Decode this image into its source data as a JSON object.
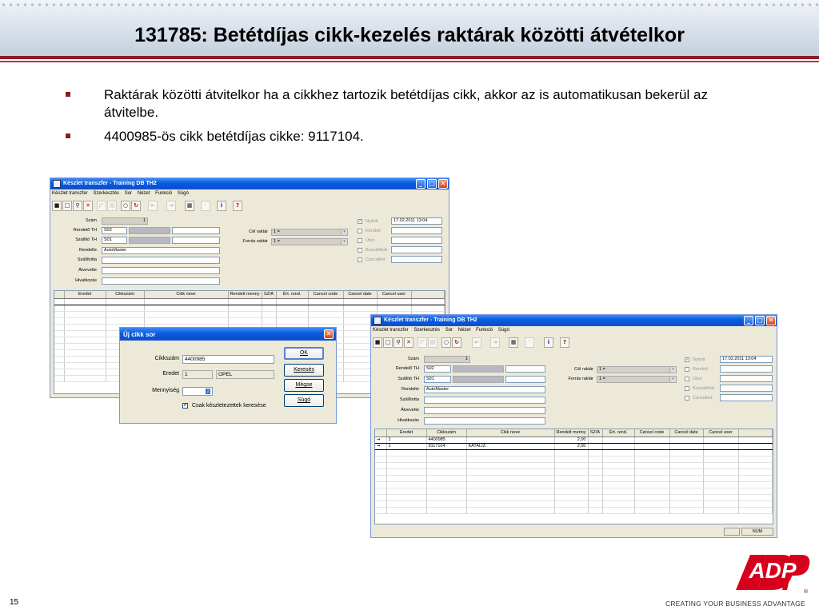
{
  "slide": {
    "title": "131785: Betétdíjas cikk-kezelés raktárak közötti átvételkor",
    "bullets": [
      "Raktárak közötti átvitelkor ha a cikkhez tartozik betétdíjas cikk, akkor az is automatikusan bekerül az átvitelbe.",
      "4400985-ös cikk betétdíjas cikke: 9117104."
    ],
    "page_number": "15",
    "brand_text": "ADP",
    "registered_mark": "®",
    "tagline": "CREATING YOUR BUSINESS ADVANTAGE",
    "accent_color": "#8b1a22"
  },
  "window_back": {
    "title": "Készlet transzfer - Training DB TH2",
    "menu": [
      "Készlet transzfer",
      "Szerkesztés",
      "Sor",
      "Nézet",
      "Funkció",
      "Súgó"
    ],
    "fields": {
      "szam_label": "Szám",
      "szam_value": "1",
      "rendelo_label": "Rendelő TH",
      "rendelo_value": "S02",
      "szallito_label": "Szállító TH",
      "szallito_value": "S01",
      "rendelte_label": "Rendelte",
      "rendelte_value": "AutoMaster",
      "szallitotta_label": "Szállította",
      "atvevette_label": "Átvevette",
      "hivatkozas_label": "Hivatkozás",
      "cel_raktar_label": "Cél raktár",
      "cel_raktar_value": "1 =",
      "forras_raktar_label": "Forrás raktár",
      "forras_raktar_value": "1 =",
      "nyitott_label": "Nyitott",
      "nyitott_date": "17.02.2011 13:04",
      "rendelt_label": "Rendelt",
      "uton_label": "Úton",
      "beszallitott_label": "Beszállított",
      "cancelled_label": "Cancelled"
    },
    "grid_headers": [
      "Eredet",
      "Cikkszám",
      "Cikk neve",
      "Rendelt menny",
      "SZ/A",
      "Ért. rend.",
      "Cancel code",
      "Cancel date",
      "Cancel user"
    ]
  },
  "dialog": {
    "title": "Új cikk sor",
    "cikkszam_label": "Cikkszám",
    "cikkszam_value": "4400985",
    "eredet_label": "Eredet",
    "eredet_value": "1",
    "eredet_name": "OPEL",
    "mennyiseg_label": "Mennyiség",
    "mennyiseg_value": "2",
    "checkbox_label": "Csak készletezettek keresése",
    "checkbox_checked": "✔",
    "buttons": {
      "ok": "OK",
      "kereses": "Keresés",
      "megse": "Mégse",
      "sugo": "Súgó"
    }
  },
  "window_front": {
    "title": "Készlet transzfer - Training DB TH2",
    "menu": [
      "Készlet transzfer",
      "Szerkesztés",
      "Sor",
      "Nézet",
      "Funkció",
      "Súgó"
    ],
    "fields": {
      "szam_label": "Szám",
      "szam_value": "1",
      "rendelo_label": "Rendelő TH",
      "rendelo_value": "S02",
      "szallito_label": "Szállító TH",
      "szallito_value": "S01",
      "rendelte_label": "Rendelte",
      "rendelte_value": "AutoMaster",
      "szallitotta_label": "Szállította",
      "atvevette_label": "Átvevette",
      "hivatkozas_label": "Hivatkozás",
      "cel_raktar_label": "Cél raktár",
      "cel_raktar_value": "1 =",
      "forras_raktar_label": "Forrás raktár",
      "forras_raktar_value": "1 =",
      "nyitott_label": "Nyitott",
      "nyitott_date": "17.02.2011 13:04",
      "rendelt_label": "Rendelt",
      "uton_label": "Úton",
      "beszallitott_label": "Beszállított",
      "cancelled_label": "Cancelled"
    },
    "grid_headers": [
      "Eredet",
      "Cikkszám",
      "Cikk neve",
      "Rendelt menny",
      "SZ/A",
      "Ért. rend.",
      "Cancel code",
      "Cancel date",
      "Cancel user"
    ],
    "rows": [
      {
        "arrow": "➞",
        "eredet": "1",
        "cikkszam": "4400985",
        "cikk_neve": "",
        "menny": "2,00"
      },
      {
        "arrow": "➞",
        "eredet": "1",
        "cikkszam": "9117104",
        "cikk_neve": "KATALIZ.",
        "menny": "2,00"
      }
    ],
    "status_num": "NUM"
  },
  "toolbar_icons": [
    "save-icon",
    "new-icon",
    "search-icon",
    "delete-icon",
    "prev-icon",
    "next-icon",
    "ok-icon",
    "refresh-icon",
    "first-icon",
    "last-icon",
    "calculator-icon",
    "back-icon",
    "info-icon",
    "help-icon"
  ],
  "toolbar_glyphs": {
    "info": "i",
    "help": "?"
  }
}
